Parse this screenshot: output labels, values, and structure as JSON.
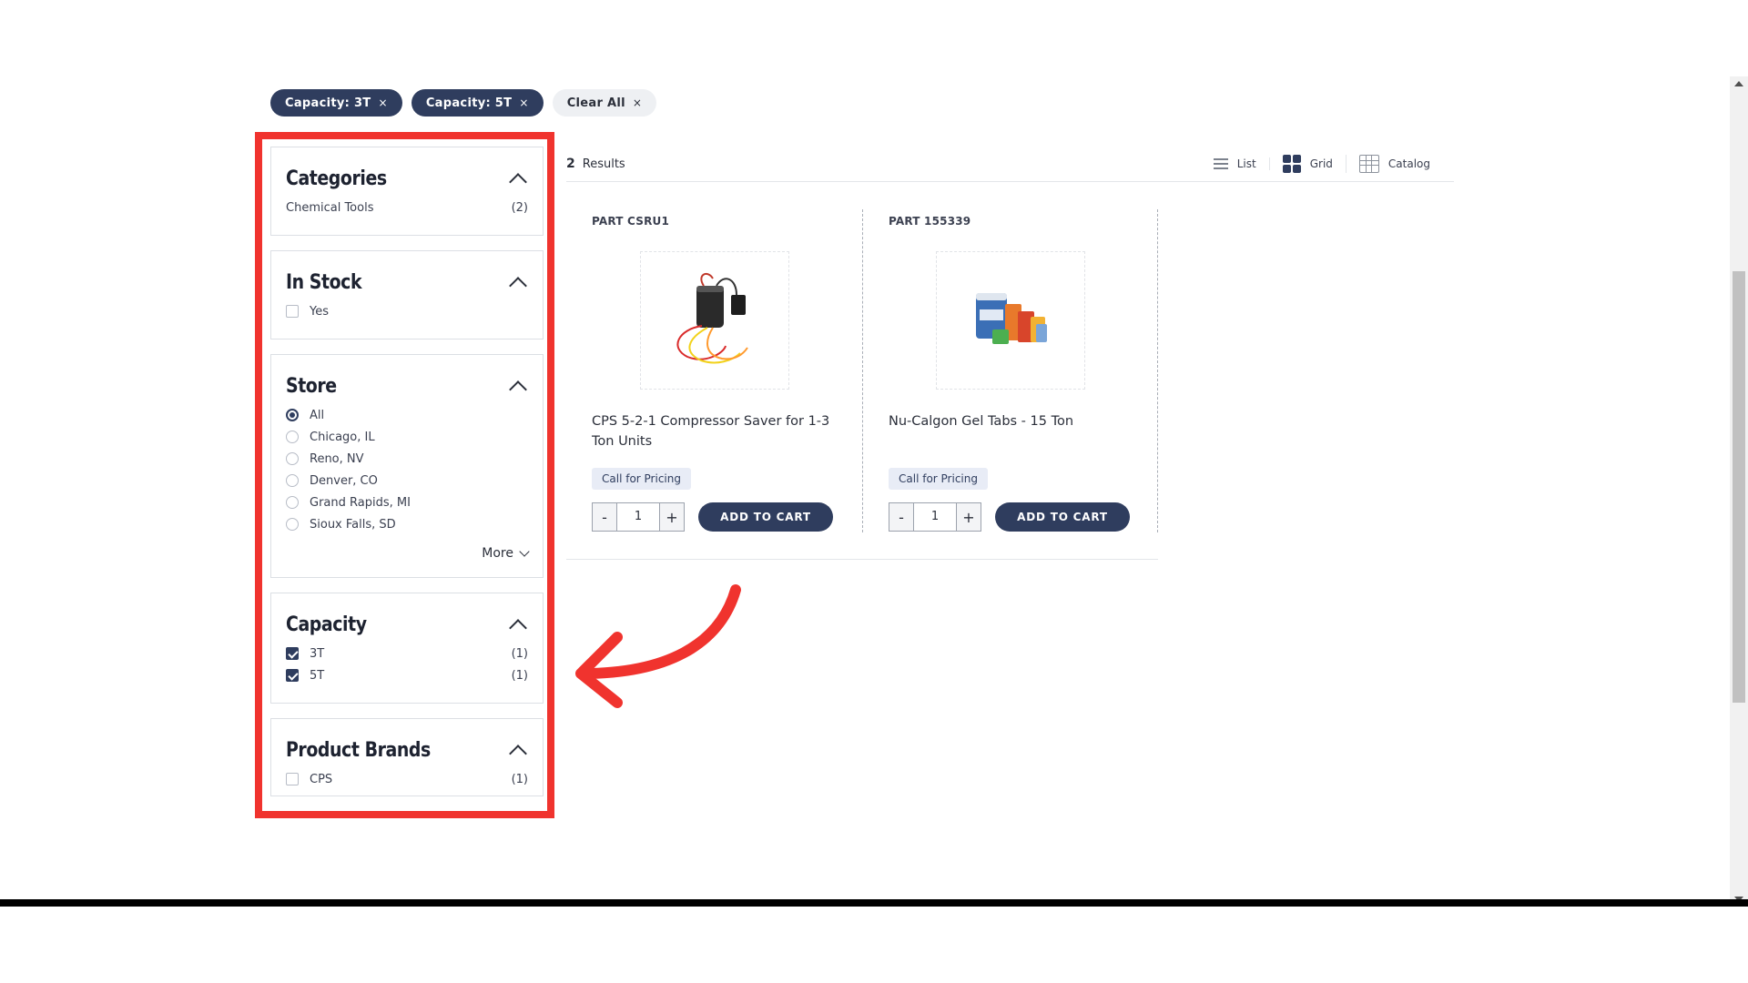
{
  "filters": {
    "active_chips": [
      {
        "label": "Capacity: 3T",
        "remove": "×"
      },
      {
        "label": "Capacity: 5T",
        "remove": "×"
      }
    ],
    "clear_all": {
      "label": "Clear All",
      "remove": "×"
    }
  },
  "sidebar": {
    "categories": {
      "title": "Categories",
      "items": [
        {
          "label": "Chemical Tools",
          "count": "(2)"
        }
      ]
    },
    "in_stock": {
      "title": "In Stock",
      "items": [
        {
          "label": "Yes",
          "checked": false
        }
      ]
    },
    "store": {
      "title": "Store",
      "options": [
        "All",
        "Chicago, IL",
        "Reno, NV",
        "Denver, CO",
        "Grand Rapids, MI",
        "Sioux Falls, SD"
      ],
      "selected": "All",
      "more_label": "More"
    },
    "capacity": {
      "title": "Capacity",
      "items": [
        {
          "label": "3T",
          "count": "(1)",
          "checked": true
        },
        {
          "label": "5T",
          "count": "(1)",
          "checked": true
        }
      ]
    },
    "product_brands": {
      "title": "Product Brands",
      "items": [
        {
          "label": "CPS",
          "count": "(1)",
          "checked": false
        }
      ]
    }
  },
  "results": {
    "count": "2",
    "label": "Results",
    "views": [
      {
        "label": "List",
        "icon": "list-icon"
      },
      {
        "label": "Grid",
        "icon": "grid-icon"
      },
      {
        "label": "Catalog",
        "icon": "catalog-icon"
      }
    ]
  },
  "products": [
    {
      "part": "PART CSRU1",
      "name": "CPS 5-2-1 Compressor Saver for 1-3 Ton Units",
      "pricing": "Call for Pricing",
      "qty": "1",
      "minus": "-",
      "plus": "+",
      "cta": "ADD TO CART"
    },
    {
      "part": "PART 155339",
      "name": "Nu-Calgon Gel Tabs - 15 Ton",
      "pricing": "Call for Pricing",
      "qty": "1",
      "minus": "-",
      "plus": "+",
      "cta": "ADD TO CART"
    }
  ],
  "colors": {
    "accent": "#2f3d5e",
    "highlight": "#f0332e"
  }
}
